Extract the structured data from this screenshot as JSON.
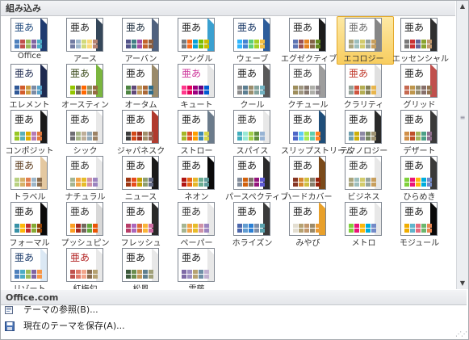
{
  "sections": {
    "builtin": "組み込み",
    "officecom": "Office.com"
  },
  "themes": [
    {
      "label": "Office",
      "strip": "#1f3b70",
      "glyph": "#1f497d",
      "sw": [
        "#4f81bd",
        "#c0504d",
        "#9bbb59",
        "#8064a2",
        "#4bacc6"
      ]
    },
    {
      "label": "アース",
      "strip": "#35475a",
      "glyph": "#222222",
      "sw": [
        "#727ca3",
        "#9fb8cd",
        "#d2da7a",
        "#fada7a",
        "#b88472"
      ]
    },
    {
      "label": "アーバン",
      "strip": "#50627f",
      "glyph": "#1a2a3a",
      "sw": [
        "#53548a",
        "#438086",
        "#a04da3",
        "#c4652d",
        "#8b5d3d"
      ]
    },
    {
      "label": "アングル",
      "strip": "#3aa0d0",
      "glyph": "#1a1a1a",
      "sw": [
        "#797b7e",
        "#f96a1b",
        "#08a1d9",
        "#7cbf00",
        "#ccbe00"
      ]
    },
    {
      "label": "ウェーブ",
      "strip": "#2d5d9b",
      "glyph": "#0f2f5f",
      "sw": [
        "#31b6fd",
        "#4584d3",
        "#5bd078",
        "#a5d028",
        "#f5c040"
      ]
    },
    {
      "label": "エグゼクティブ",
      "strip": "#1c1c1c",
      "glyph": "#1c1c1c",
      "sw": [
        "#6076b4",
        "#9c5252",
        "#e68422",
        "#846648",
        "#63891f"
      ]
    },
    {
      "label": "エコロジー",
      "strip": "#868686",
      "glyph": "#6a6a6a",
      "sw": [
        "#a9a57c",
        "#9cbebd",
        "#d2cb6c",
        "#95a39d",
        "#c89f5d"
      ],
      "selected": true
    },
    {
      "label": "エッセンシャル",
      "strip": "#2f2f2f",
      "glyph": "#1a1a1a",
      "sw": [
        "#7a7a7a",
        "#cc3333",
        "#666699",
        "#8aa32f",
        "#c3986d"
      ]
    },
    {
      "label": "エレメント",
      "strip": "#1e2a50",
      "glyph": "#1e2a50",
      "sw": [
        "#2f5897",
        "#d25c2c",
        "#cb9c42",
        "#7b8ba4",
        "#57a2c9"
      ]
    },
    {
      "label": "オースティン",
      "strip": "#7bb63f",
      "glyph": "#3a4a1a",
      "sw": [
        "#94c600",
        "#71685a",
        "#ff6700",
        "#909465",
        "#956b43"
      ]
    },
    {
      "label": "オータム",
      "strip": "#9a8a6a",
      "glyph": "#222222",
      "sw": [
        "#4e8542",
        "#604878",
        "#c19859",
        "#aa6837",
        "#2e6b8a"
      ]
    },
    {
      "label": "キュート",
      "strip": "#e6e6e6",
      "glyph": "#cc3399",
      "sw": [
        "#ff388c",
        "#e40059",
        "#9c007f",
        "#68007f",
        "#005bd3"
      ]
    },
    {
      "label": "クール",
      "strip": "#595959",
      "glyph": "#1a1a1a",
      "sw": [
        "#8c8c8c",
        "#5c7f92",
        "#9c8e6c",
        "#84a49e",
        "#72b3c2"
      ]
    },
    {
      "label": "クチュール",
      "strip": "#9d9d9d",
      "glyph": "#333333",
      "sw": [
        "#9e8e5c",
        "#a09781",
        "#85776d",
        "#aeafa9",
        "#8d878b"
      ]
    },
    {
      "label": "クラリティ",
      "strip": "#e0e0e0",
      "glyph": "#c0392b",
      "sw": [
        "#93a299",
        "#cf543f",
        "#b5ae53",
        "#848058",
        "#e8b54d"
      ]
    },
    {
      "label": "グリッド",
      "strip": "#c0504d",
      "glyph": "#1a1a1a",
      "sw": [
        "#c66951",
        "#bf974d",
        "#928b70",
        "#87706b",
        "#94734e"
      ]
    },
    {
      "label": "コンポジット",
      "strip": "#1a1a1a",
      "glyph": "#1a1a1a",
      "sw": [
        "#98c723",
        "#59b0b9",
        "#deae00",
        "#b77bb4",
        "#e0773c"
      ]
    },
    {
      "label": "シック",
      "strip": "#e8e8e8",
      "glyph": "#333333",
      "sw": [
        "#6f6f74",
        "#a7b789",
        "#beae98",
        "#92a9b9",
        "#9c8265"
      ]
    },
    {
      "label": "ジャパネスク",
      "strip": "#b03a2e",
      "glyph": "#1a1a1a",
      "sw": [
        "#3c3c3c",
        "#d34817",
        "#9b2d1f",
        "#a28e6a",
        "#956251"
      ]
    },
    {
      "label": "ストロー",
      "strip": "#6b7b8b",
      "glyph": "#1a1a1a",
      "sw": [
        "#a6b727",
        "#df5327",
        "#fe9e00",
        "#418ab3",
        "#d7d447"
      ]
    },
    {
      "label": "スパイス",
      "strip": "#e8e8e8",
      "glyph": "#333333",
      "sw": [
        "#41aebd",
        "#97e9d5",
        "#a2cf49",
        "#608f3d",
        "#98b4d4"
      ]
    },
    {
      "label": "スリップストリーム",
      "strip": "#1f4e79",
      "glyph": "#1a1a1a",
      "sw": [
        "#4e67c8",
        "#5eccf3",
        "#a7ea52",
        "#5dceaf",
        "#ff8021"
      ]
    },
    {
      "label": "テクノロジー",
      "strip": "#2a2a2a",
      "glyph": "#1a1a1a",
      "sw": [
        "#6ea0b0",
        "#ccaf0a",
        "#8d89a4",
        "#748560",
        "#9e9273"
      ]
    },
    {
      "label": "デザート",
      "strip": "#3a3a3a",
      "glyph": "#1a1a1a",
      "sw": [
        "#d19049",
        "#bf4f2b",
        "#a6b65c",
        "#4da087",
        "#8f6e8e"
      ]
    },
    {
      "label": "トラベル",
      "strip": "#e4c8a0",
      "glyph": "#5a3a1a",
      "sw": [
        "#b8d181",
        "#d6b168",
        "#e27f4f",
        "#9cb5c8",
        "#8a6d4f"
      ]
    },
    {
      "label": "ナチュラル",
      "strip": "#e8e8e8",
      "glyph": "#333333",
      "sw": [
        "#a5b592",
        "#f3a447",
        "#e7bc29",
        "#d092a7",
        "#9c85c0"
      ]
    },
    {
      "label": "ニュース",
      "strip": "#1a1a1a",
      "glyph": "#1a1a1a",
      "sw": [
        "#9d3511",
        "#e84b1c",
        "#c5a000",
        "#8e9e70",
        "#646b86"
      ]
    },
    {
      "label": "ネオン",
      "strip": "#0a0a0a",
      "glyph": "#1a1a1a",
      "sw": [
        "#b01513",
        "#ea6312",
        "#e6b729",
        "#6aac90",
        "#5f9c9d"
      ]
    },
    {
      "label": "パースペクティブ",
      "strip": "#2a2a2a",
      "glyph": "#1a1a1a",
      "sw": [
        "#838d9b",
        "#d2610c",
        "#80716a",
        "#94147c",
        "#5d5ad2"
      ]
    },
    {
      "label": "ハードカバー",
      "strip": "#7a4a1a",
      "glyph": "#1a1a1a",
      "sw": [
        "#873624",
        "#d6862d",
        "#d0be40",
        "#877f6c",
        "#972109"
      ]
    },
    {
      "label": "ビジネス",
      "strip": "#e8e8e8",
      "glyph": "#333333",
      "sw": [
        "#a9a57c",
        "#9cbebd",
        "#d2cb6c",
        "#95a39d",
        "#c89f5d"
      ]
    },
    {
      "label": "ひらめき",
      "strip": "#3a3a3a",
      "glyph": "#1a1a1a",
      "sw": [
        "#7fd13b",
        "#ea157a",
        "#feb80a",
        "#00addc",
        "#738ac8"
      ]
    },
    {
      "label": "フォーマル",
      "strip": "#0a0a0a",
      "glyph": "#1a1a1a",
      "sw": [
        "#3891a7",
        "#feb80a",
        "#c32d2e",
        "#84aa33",
        "#964305"
      ]
    },
    {
      "label": "プッシュピン",
      "strip": "#d8d8d8",
      "glyph": "#333333",
      "sw": [
        "#fda023",
        "#aa2b1e",
        "#71685c",
        "#64a73b",
        "#eb5605"
      ]
    },
    {
      "label": "フレッシュ",
      "strip": "#2a2a2a",
      "glyph": "#1a1a1a",
      "sw": [
        "#b83d68",
        "#ac66bb",
        "#de6c36",
        "#f9b639",
        "#cf6da4"
      ]
    },
    {
      "label": "ペーパー",
      "strip": "#e8e8e8",
      "glyph": "#333333",
      "sw": [
        "#a5b592",
        "#f3a447",
        "#e7bc29",
        "#d092a7",
        "#9c85c0"
      ]
    },
    {
      "label": "ホライズン",
      "strip": "#3a3a3a",
      "glyph": "#1a1a1a",
      "sw": [
        "#4a66ac",
        "#629dd1",
        "#297fd5",
        "#7f8fa9",
        "#5aa2ae"
      ]
    },
    {
      "label": "みやび",
      "strip": "#e8a02a",
      "glyph": "#1a1a1a",
      "sw": [
        "#e3ded1",
        "#b6a272",
        "#c3986d",
        "#9a8a6a",
        "#eb9c34"
      ]
    },
    {
      "label": "メトロ",
      "strip": "#e8e8e8",
      "glyph": "#333333",
      "sw": [
        "#7fd13b",
        "#ea157a",
        "#feb80a",
        "#00addc",
        "#738ac8"
      ]
    },
    {
      "label": "モジュール",
      "strip": "#0a0a0a",
      "glyph": "#1a1a1a",
      "sw": [
        "#f0ad00",
        "#60b5cc",
        "#e66c7d",
        "#6bb76d",
        "#e88651"
      ]
    },
    {
      "label": "リゾート",
      "strip": "#dbe8f4",
      "glyph": "#1a3a6a",
      "sw": [
        "#4f81bd",
        "#4bacc6",
        "#9bbb59",
        "#8064a2",
        "#f79646"
      ]
    },
    {
      "label": "紅梅匂",
      "strip": "#e8e8e8",
      "glyph": "#b22222",
      "sw": [
        "#c0504d",
        "#e07b6b",
        "#f2a58b",
        "#8a6d4f",
        "#b6a272"
      ]
    },
    {
      "label": "松風",
      "strip": "#e8e8e8",
      "glyph": "#1a1a1a",
      "sw": [
        "#3c5a3c",
        "#6b8e4e",
        "#c19859",
        "#5f7f8f",
        "#a0a07a"
      ]
    },
    {
      "label": "雪藤",
      "strip": "#e8e8e8",
      "glyph": "#1a1a1a",
      "sw": [
        "#7f6aa6",
        "#9c8dc0",
        "#b6a272",
        "#6f8fa6",
        "#c0b0d0"
      ]
    }
  ],
  "thumb_glyph": "亜あ",
  "menu": {
    "browse": "テーマの参照(B)...",
    "save": "現在のテーマを保存(A)..."
  }
}
